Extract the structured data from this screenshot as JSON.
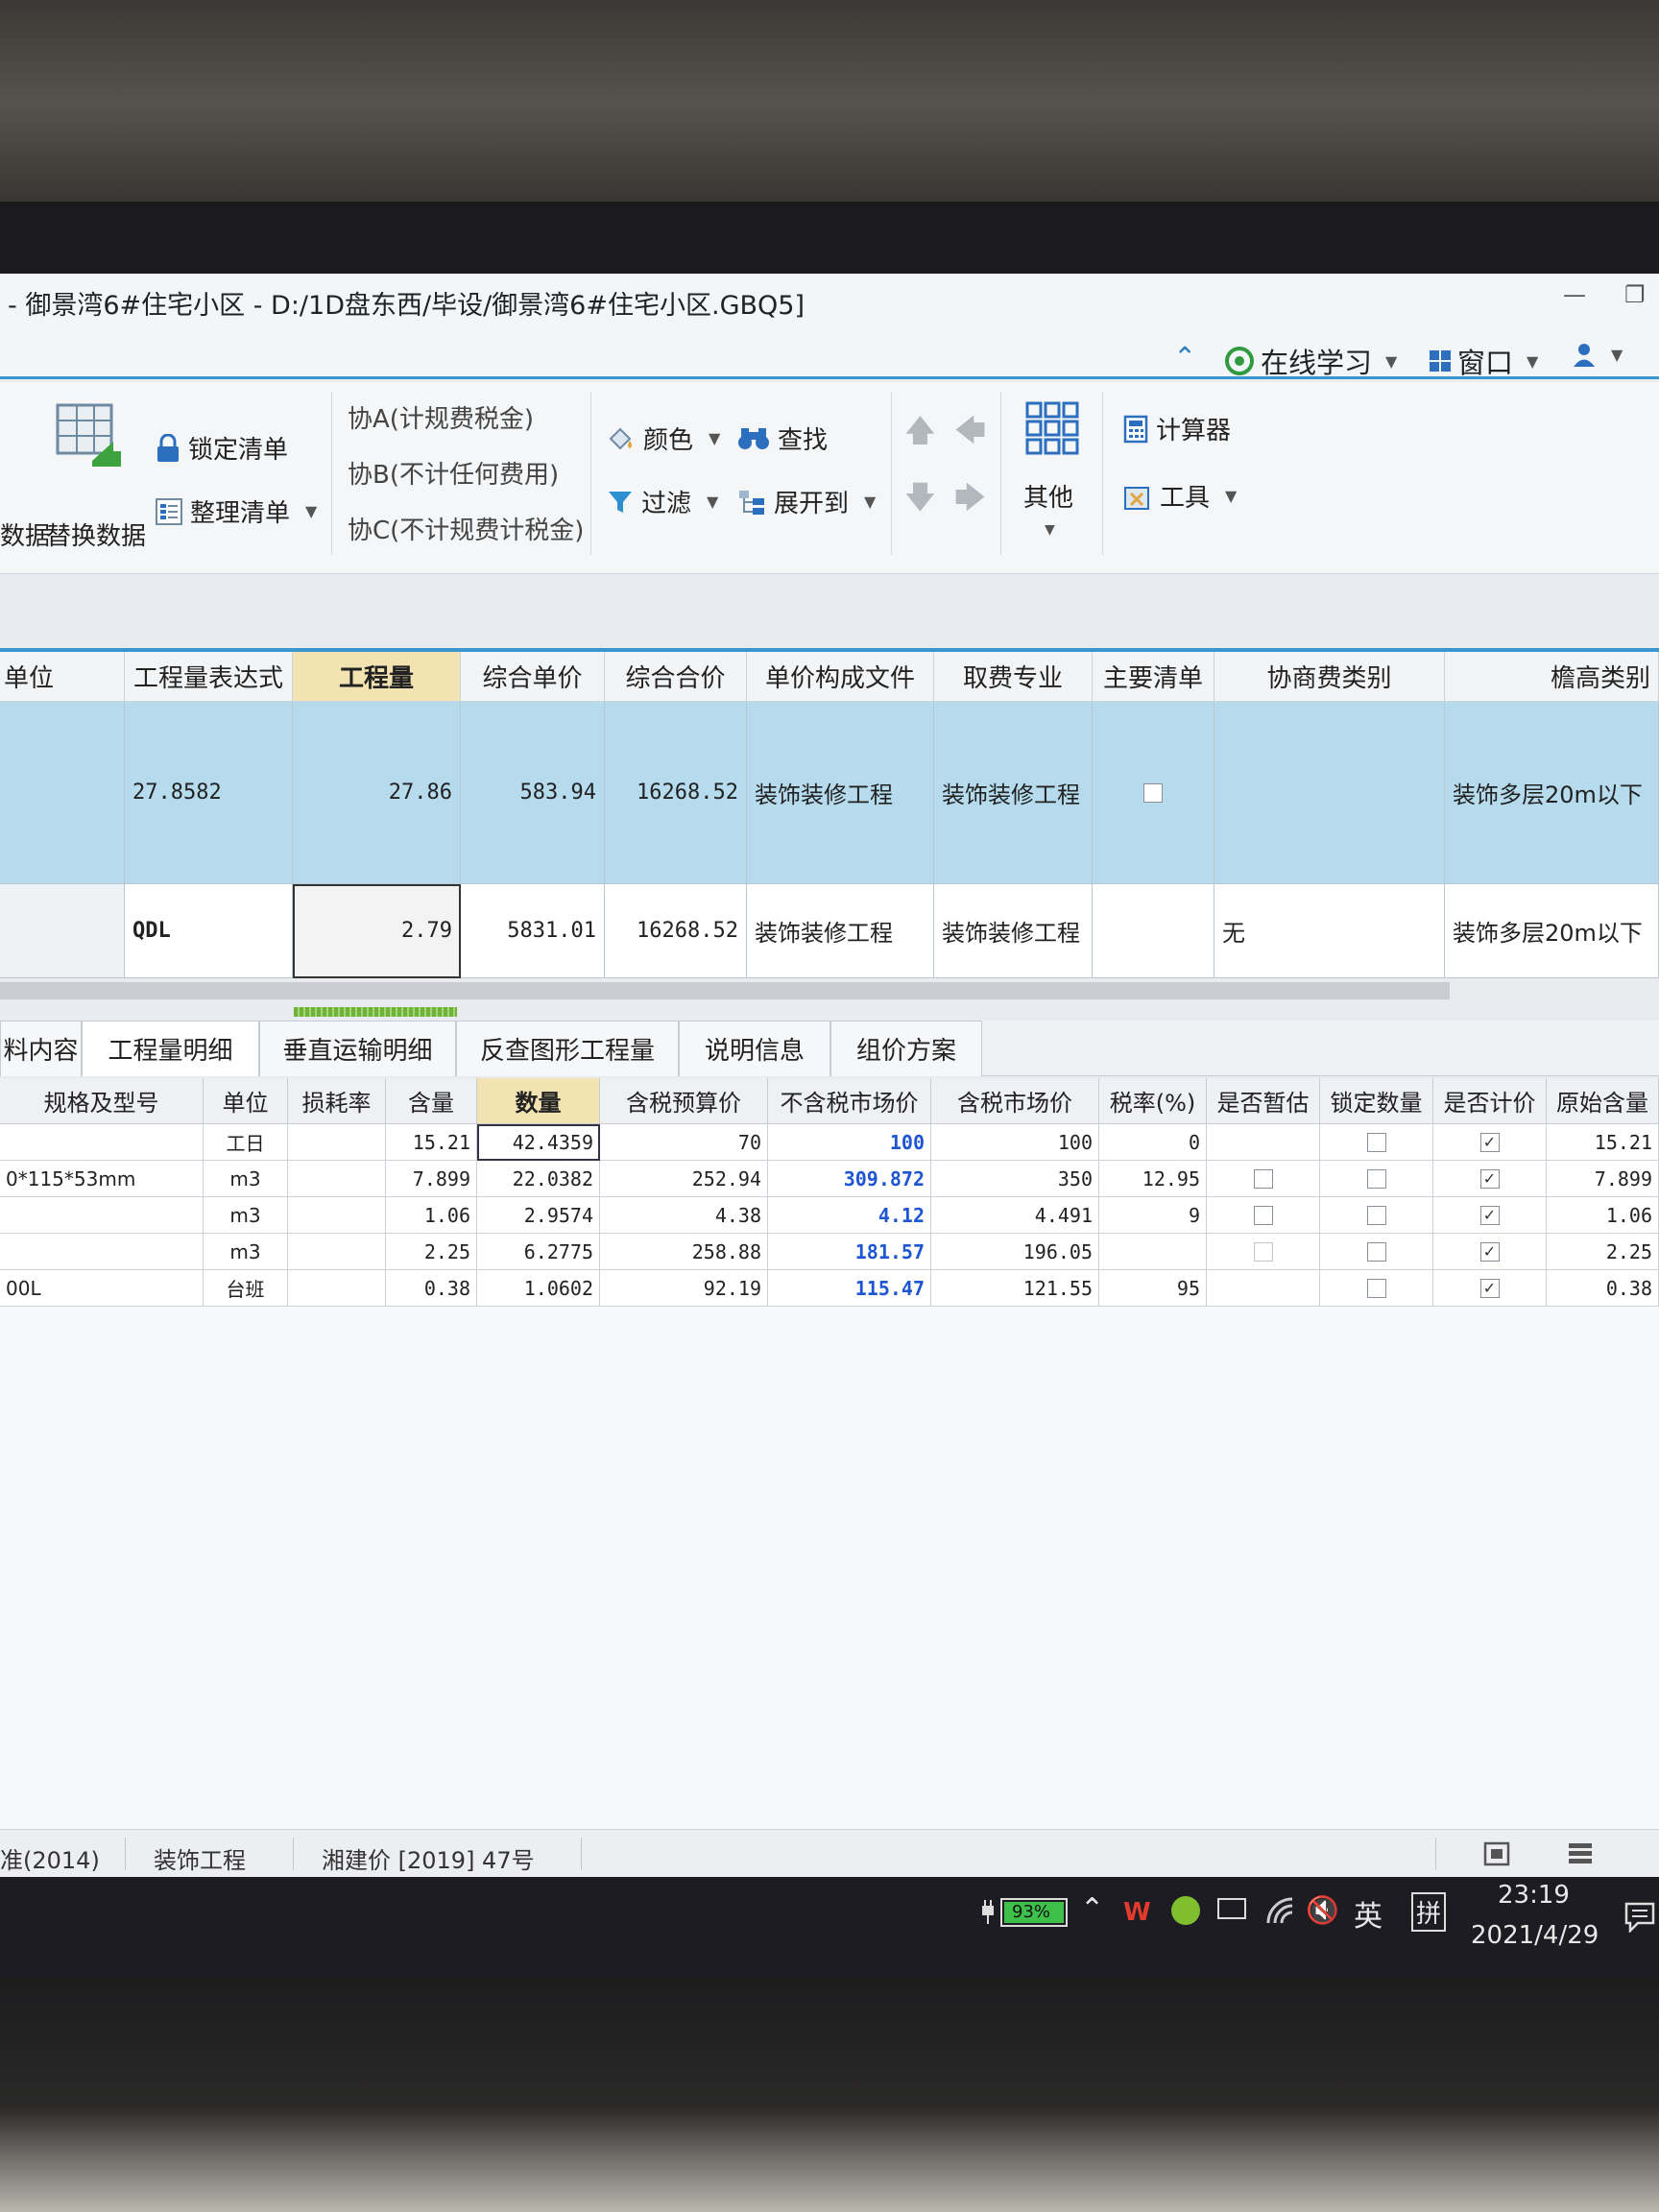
{
  "window": {
    "title": "- 御景湾6#住宅小区 - D:/1D盘东西/毕设/御景湾6#住宅小区.GBQ5]"
  },
  "helpbar": {
    "online_learning": "在线学习",
    "window_menu": "窗口"
  },
  "ribbon": {
    "data_label": "数据",
    "replace_data": "替换数据",
    "lock_list": "锁定清单",
    "organize_list": "整理清单",
    "xie_a": "协A(计规费税金)",
    "xie_b": "协B(不计任何费用)",
    "xie_c": "协C(不计规费计税金)",
    "color": "颜色",
    "find": "查找",
    "filter": "过滤",
    "expand_to": "展开到",
    "other": "其他",
    "calculator": "计算器",
    "tools": "工具"
  },
  "upper_grid": {
    "columns": [
      "单位",
      "工程量表达式",
      "工程量",
      "综合单价",
      "综合合价",
      "单价构成文件",
      "取费专业",
      "主要清单",
      "协商费类别",
      "檐高类别"
    ],
    "rows": [
      {
        "expr": "27.8582",
        "qty": "27.86",
        "unit_price": "583.94",
        "total": "16268.52",
        "price_file": "装饰装修工程",
        "fee_major": "装饰装修工程",
        "main_list": false,
        "negotiation": "",
        "eave": "装饰多层20m以下"
      },
      {
        "expr": "QDL",
        "qty": "2.79",
        "unit_price": "5831.01",
        "total": "16268.52",
        "price_file": "装饰装修工程",
        "fee_major": "装饰装修工程",
        "main_list": null,
        "negotiation": "无",
        "eave": "装饰多层20m以下"
      }
    ]
  },
  "tabs": [
    "料内容",
    "工程量明细",
    "垂直运输明细",
    "反查图形工程量",
    "说明信息",
    "组价方案"
  ],
  "lower_grid": {
    "columns": [
      "规格及型号",
      "单位",
      "损耗率",
      "含量",
      "数量",
      "含税预算价",
      "不含税市场价",
      "含税市场价",
      "税率(%)",
      "是否暂估",
      "锁定数量",
      "是否计价",
      "原始含量"
    ],
    "rows": [
      {
        "spec": "",
        "unit": "工日",
        "loss": "",
        "content": "15.21",
        "qty": "42.4359",
        "budget": "70",
        "market_ex": "100",
        "market_in": "100",
        "tax": "0",
        "provisional": null,
        "lock": false,
        "priced": true,
        "orig": "15.21"
      },
      {
        "spec": "0*115*53mm",
        "unit": "m3",
        "loss": "",
        "content": "7.899",
        "qty": "22.0382",
        "budget": "252.94",
        "market_ex": "309.872",
        "market_in": "350",
        "tax": "12.95",
        "provisional": false,
        "lock": false,
        "priced": true,
        "orig": "7.899"
      },
      {
        "spec": "",
        "unit": "m3",
        "loss": "",
        "content": "1.06",
        "qty": "2.9574",
        "budget": "4.38",
        "market_ex": "4.12",
        "market_in": "4.491",
        "tax": "9",
        "provisional": false,
        "lock": false,
        "priced": true,
        "orig": "1.06"
      },
      {
        "spec": "",
        "unit": "m3",
        "loss": "",
        "content": "2.25",
        "qty": "6.2775",
        "budget": "258.88",
        "market_ex": "181.57",
        "market_in": "196.05",
        "tax": "",
        "provisional": "dim",
        "lock": false,
        "priced": true,
        "orig": "2.25"
      },
      {
        "spec": "00L",
        "unit": "台班",
        "loss": "",
        "content": "0.38",
        "qty": "1.0602",
        "budget": "92.19",
        "market_ex": "115.47",
        "market_in": "121.55",
        "tax": "95",
        "provisional": null,
        "lock": false,
        "priced": true,
        "orig": "0.38"
      }
    ]
  },
  "statusbar": {
    "standard": "准(2014)",
    "project_type": "装饰工程",
    "price_doc": "湘建价 [2019] 47号"
  },
  "taskbar": {
    "battery": "93%",
    "ime_lang": "英",
    "ime_mode": "拼",
    "time": "23:19",
    "date": "2021/4/29"
  },
  "colors": {
    "accent": "#3b95cf",
    "selected_row": "#b5dbed",
    "header_highlight": "#f3e3b3",
    "market_price_blue": "#1e55d2"
  }
}
